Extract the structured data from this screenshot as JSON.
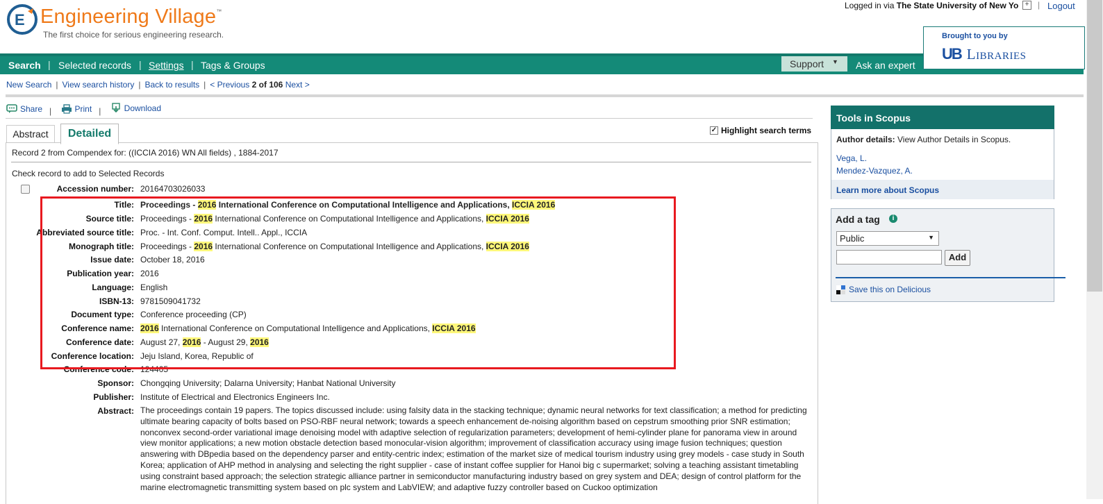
{
  "header": {
    "logo_text": "Engineering Village",
    "logo_tm": "™",
    "tagline": "The first choice for serious engineering research.",
    "login_prefix": "Logged in via",
    "login_institution": "The State University of New Yo",
    "logout": "Logout",
    "brought_by": "Brought to you by",
    "ub_mark": "UB",
    "ub_libraries": "Libraries"
  },
  "nav": {
    "search": "Search",
    "selected_records": "Selected records",
    "settings": "Settings",
    "tags_groups": "Tags & Groups",
    "support": "Support",
    "ask_expert": "Ask an expert"
  },
  "breadcrumbs": {
    "new_search": "New Search",
    "view_history": "View search history",
    "back_results": "Back to results",
    "previous": "< Previous",
    "position": "2 of 106",
    "next": "Next >"
  },
  "actions": {
    "share": "Share",
    "print": "Print",
    "download": "Download"
  },
  "tabs": {
    "abstract": "Abstract",
    "detailed": "Detailed"
  },
  "highlight_label": "Highlight search terms",
  "record": {
    "source_line": "Record 2 from Compendex for: ((ICCIA 2016) WN All fields) , 1884-2017",
    "check_label": "Check record to add to Selected Records",
    "accession_label": "Accession number:",
    "accession_value": "20164703026033",
    "title_label": "Title:",
    "title_a": "Proceedings - ",
    "title_b": "2016",
    "title_c": " International Conference on Computational Intelligence and Applications, ",
    "title_d": "ICCIA 2016",
    "source_title_label": "Source title:",
    "abbrev_label": "Abbreviated source title:",
    "abbrev_value": "Proc. - Int. Conf. Comput. Intell.. Appl., ICCIA",
    "monograph_label": "Monograph title:",
    "issue_date_label": "Issue date:",
    "issue_date_value": "October 18, 2016",
    "pub_year_label": "Publication year:",
    "pub_year_value": "2016",
    "language_label": "Language:",
    "language_value": "English",
    "isbn_label": "ISBN-13:",
    "isbn_value": "9781509041732",
    "doctype_label": "Document type:",
    "doctype_value": "Conference proceeding (CP)",
    "conf_name_label": "Conference name:",
    "conf_name_a": "2016",
    "conf_name_b": " International Conference on Computational Intelligence and Applications, ",
    "conf_name_c": "ICCIA 2016",
    "conf_date_label": "Conference date:",
    "conf_date_a": "August 27, ",
    "conf_date_b": "2016",
    "conf_date_c": " - August 29, ",
    "conf_date_d": "2016",
    "conf_loc_label": "Conference location:",
    "conf_loc_value": "Jeju Island, Korea, Republic of",
    "conf_code_label": "Conference code:",
    "conf_code_value": "124405",
    "sponsor_label": "Sponsor:",
    "sponsor_value": "Chongqing University; Dalarna University; Hanbat National University",
    "publisher_label": "Publisher:",
    "publisher_value": "Institute of Electrical and Electronics Engineers Inc.",
    "abstract_label": "Abstract:",
    "abstract_value": "The proceedings contain 19 papers. The topics discussed include: using falsity data in the stacking technique; dynamic neural networks for text classification; a method for predicting ultimate bearing capacity of bolts based on PSO-RBF neural network; towards a speech enhancement de-noising algorithm based on cepstrum smoothing prior SNR estimation; nonconvex second-order variational image denoising model with adaptive selection of regularization parameters; development of hemi-cylinder plane for panorama view in around view monitor applications; a new motion obstacle detection based monocular-vision algorithm; improvement of classification accuracy using image fusion techniques; question answering with DBpedia based on the dependency parser and entity-centric index; estimation of the market size of medical tourism industry using grey models - case study in South Korea; application of AHP method in analysing and selecting the right supplier - case of instant coffee supplier for Hanoi big c supermarket; solving a teaching assistant timetabling using constraint based approach; the selection strategic alliance partner in semiconductor manufacturing industry based on grey system and DEA; design of control platform for the marine electromagnetic transmitting system based on plc system and LabVIEW; and adaptive fuzzy controller based on Cuckoo optimization"
  },
  "scopus": {
    "title": "Tools in Scopus",
    "author_details_label": "Author details:",
    "author_details_text": " View Author Details in Scopus.",
    "author1": "Vega, L.",
    "author2": "Mendez-Vazquez, A.",
    "learn_more": "Learn more about Scopus"
  },
  "tag": {
    "title": "Add a tag",
    "select_value": "Public",
    "add_button": "Add",
    "delicious": "Save this on Delicious"
  },
  "colors": {
    "brand_orange": "#ef7a1a",
    "nav_green": "#148a78",
    "highlight": "#fef77a",
    "red_box": "#e8191f",
    "link_blue": "#1a4fa0"
  }
}
